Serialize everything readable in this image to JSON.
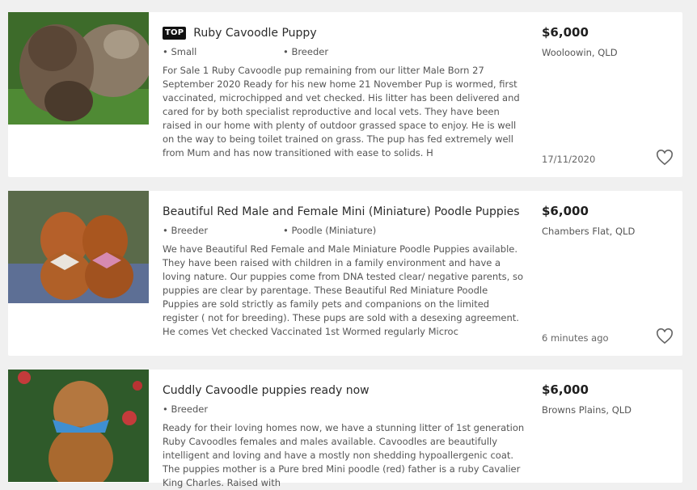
{
  "listings": [
    {
      "badge": "TOP",
      "title": "Ruby Cavoodle Puppy",
      "attr1": "• Small",
      "attr2": "• Breeder",
      "description": "For Sale 1 Ruby Cavoodle pup remaining from our litter Male Born 27 September 2020 Ready for his new home 21 November Pup is wormed, first vaccinated, microchipped and vet checked. His litter has been delivered and cared for by both specialist reproductive and local vets. They have been raised in our home with plenty of outdoor grassed space to enjoy. He is well on the way to being toilet trained on grass. The pup has fed extremely well from Mum and has now transitioned with ease to solids. H",
      "price": "$6,000",
      "location": "Wooloowin, QLD",
      "date": "17/11/2020",
      "icon": "heart-icon"
    },
    {
      "title": "Beautiful Red Male and Female Mini (Miniature) Poodle Puppies",
      "attr1": "• Breeder",
      "attr2": "• Poodle (Miniature)",
      "description": "We have Beautiful Red Female and Male Miniature Poodle Puppies available. They have been raised with children in a family environment and have a loving nature. Our puppies come from DNA tested clear/ negative parents, so puppies are clear by parentage. These Beautiful Red Miniature Poodle Puppies are sold strictly as family pets and companions on the limited register ( not for breeding). These pups are sold with a desexing agreement. He comes Vet checked Vaccinated 1st Wormed regularly Microc",
      "price": "$6,000",
      "location": "Chambers Flat, QLD",
      "date": "6 minutes ago",
      "icon": "heart-icon"
    },
    {
      "title": "Cuddly Cavoodle puppies ready now",
      "attr1": "• Breeder",
      "description": "Ready for their loving homes now, we have a stunning litter of 1st generation Ruby Cavoodles females and males available. Cavoodles are beautifully intelligent and loving and have a mostly non shedding hypoallergenic coat. The puppies mother is a Pure bred Mini poodle (red) father is a ruby Cavalier King Charles. Raised with",
      "price": "$6,000",
      "location": "Browns Plains, QLD"
    }
  ],
  "colors": {
    "badge": "#111111",
    "background": "#f0f0f0",
    "card": "#ffffff"
  }
}
